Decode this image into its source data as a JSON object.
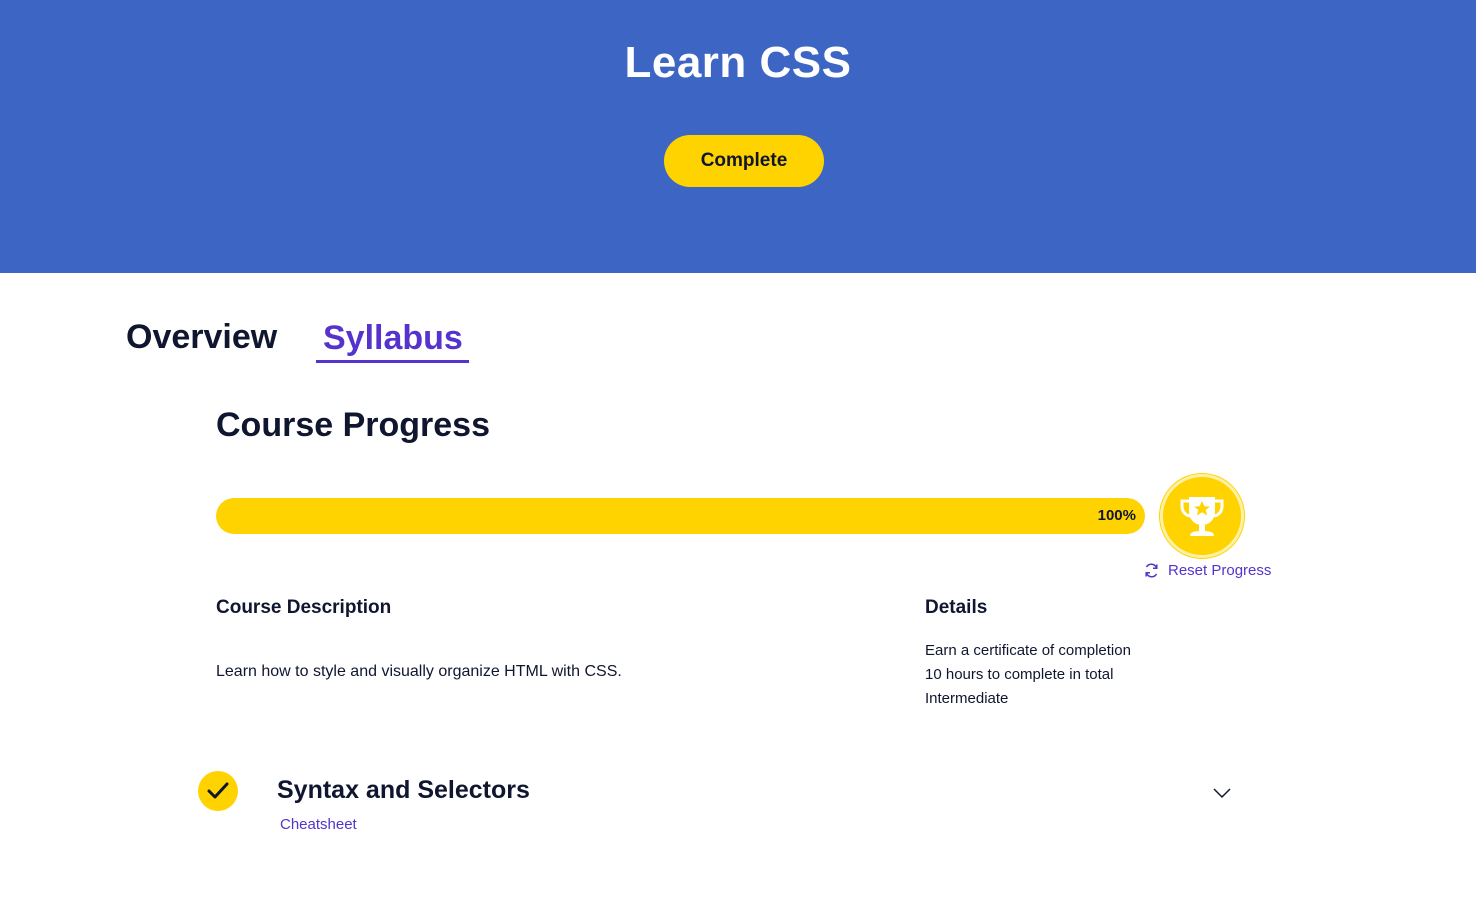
{
  "hero": {
    "title": "Learn CSS",
    "button_label": "Complete",
    "background_color": "#3c65c4",
    "button_color": "#ffd300"
  },
  "tabs": [
    {
      "label": "Overview",
      "active": false
    },
    {
      "label": "Syllabus",
      "active": true
    }
  ],
  "progress": {
    "title": "Course Progress",
    "percent_label": "100%",
    "percent_value": 100,
    "badge_icon": "trophy-star-icon",
    "reset_icon": "refresh-icon",
    "reset_label": "Reset Progress"
  },
  "description": {
    "heading": "Course Description",
    "text": "Learn how to style and visually organize HTML with CSS."
  },
  "details": {
    "heading": "Details",
    "items": [
      "Earn a certificate of completion",
      "10 hours to complete in total",
      "Intermediate"
    ]
  },
  "modules": [
    {
      "title": "Syntax and Selectors",
      "status_icon": "checkmark-icon",
      "link_label": "Cheatsheet",
      "expand_icon": "chevron-down-icon",
      "completed": true
    }
  ],
  "colors": {
    "accent_purple": "#5533cc",
    "yellow": "#ffd300",
    "text_dark": "#10162f"
  }
}
